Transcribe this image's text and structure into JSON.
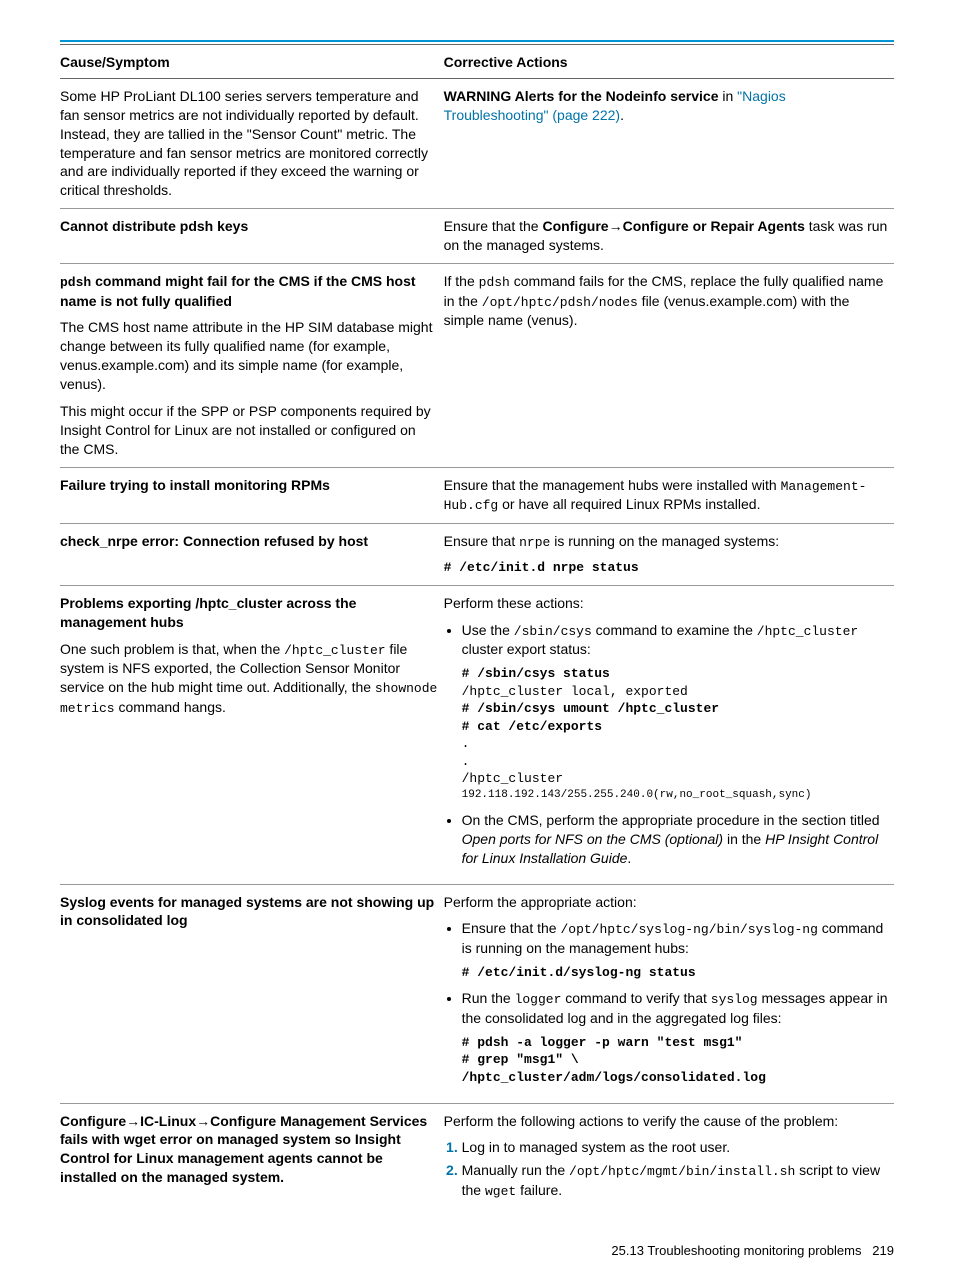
{
  "header": {
    "cause": "Cause/Symptom",
    "action": "Corrective Actions"
  },
  "rows": {
    "r1": {
      "cause": "Some HP ProLiant DL100 series servers temperature and fan sensor metrics are not individually reported by default. Instead, they are tallied in the \"Sensor Count\" metric. The temperature and fan sensor metrics are monitored correctly and are individually reported if they exceed the warning or critical thresholds.",
      "action_pre": "WARNING Alerts for the Nodeinfo service",
      "action_mid": " in ",
      "action_link": "\"Nagios Troubleshooting\" (page 222)",
      "action_post": "."
    },
    "r2": {
      "cause": "Cannot distribute pdsh keys",
      "a1": "Ensure that the ",
      "a2": "Configure",
      "a3": "→",
      "a4": "Configure or Repair Agents",
      "a5": " task was run on the managed systems."
    },
    "r3": {
      "c_code": "pdsh",
      "c1": " command might fail for the CMS if the CMS host name is not fully qualified",
      "p1": "The CMS host name attribute in the HP SIM database might change between its fully qualified name (for example, venus.example.com) and its simple name (for example, venus).",
      "p2": "This might occur if the SPP or PSP components required by Insight Control for Linux are not installed or configured on the CMS.",
      "a1": "If the ",
      "a2": "pdsh",
      "a3": " command fails for the CMS, replace the fully qualified name in the ",
      "a4": "/opt/hptc/pdsh/nodes",
      "a5": " file (venus.example.com) with the simple name (venus)."
    },
    "r4": {
      "cause": "Failure trying to install monitoring RPMs",
      "a1": "Ensure that the management hubs were installed with ",
      "a2": "Management-Hub.cfg",
      "a3": " or have all required Linux RPMs installed."
    },
    "r5": {
      "cause": "check_nrpe error: Connection refused by host",
      "a1": "Ensure that ",
      "a2": "nrpe",
      "a3": " is running on the managed systems:",
      "cmd": "# /etc/init.d nrpe status"
    },
    "r6": {
      "cause": "Problems exporting /hptc_cluster across the management hubs",
      "p1a": "One such problem is that, when the ",
      "p1b": "/hptc_cluster",
      "p1c": " file system is NFS exported, the Collection Sensor Monitor service on the hub might time out. Additionally, the ",
      "p1d": "shownode metrics",
      "p1e": " command hangs.",
      "a_intro": "Perform these actions:",
      "li1a": "Use the ",
      "li1b": "/sbin/csys",
      "li1c": " command to examine the ",
      "li1d": "/hptc_cluster",
      "li1e": " cluster export status:",
      "cmd1": "# /sbin/csys status",
      "cmd2": "  /hptc_cluster local, exported",
      "cmd3": "# /sbin/csys umount /hptc_cluster",
      "cmd4": "# cat /etc/exports",
      "cmd5": ".",
      "cmd6": ".",
      "cmd7": " /hptc_cluster",
      "cmd8": "192.118.192.143/255.255.240.0(rw,no_root_squash,sync)",
      "li2a": "On the CMS, perform the appropriate procedure in the section titled ",
      "li2b": "Open ports for NFS on the CMS (optional)",
      "li2c": " in the ",
      "li2d": "HP Insight Control for Linux Installation Guide",
      "li2e": "."
    },
    "r7": {
      "cause": "Syslog events for managed systems are not showing up in consolidated log",
      "a_intro": "Perform the appropriate action:",
      "li1a": "Ensure that the ",
      "li1b": "/opt/hptc/syslog-ng/bin/syslog-ng",
      "li1c": " command is running on the management hubs:",
      "cmd1": "# /etc/init.d/syslog-ng status",
      "li2a": "Run the ",
      "li2b": "logger",
      "li2c": " command to verify that ",
      "li2d": "syslog",
      "li2e": " messages appear in the consolidated log and in the aggregated log files:",
      "cmd2": "# pdsh -a logger -p warn \"test msg1\"",
      "cmd3": "# grep \"msg1\" \\",
      "cmd4": "/hptc_cluster/adm/logs/consolidated.log"
    },
    "r8": {
      "c1": "Configure",
      "c2": "→",
      "c3": "IC-Linux",
      "c4": "→",
      "c5": "Configure Management Services fails with wget error on managed system so Insight Control for Linux management agents cannot be installed on the managed system.",
      "a_intro": "Perform the following actions to verify the cause of the problem:",
      "li1": "Log in to managed system as the root user.",
      "li2a": "Manually run the ",
      "li2b": "/opt/hptc/mgmt/bin/install.sh",
      "li2c": " script to view the ",
      "li2d": "wget",
      "li2e": " failure."
    }
  },
  "footer": {
    "section": "25.13 Troubleshooting monitoring problems",
    "page": "219"
  }
}
